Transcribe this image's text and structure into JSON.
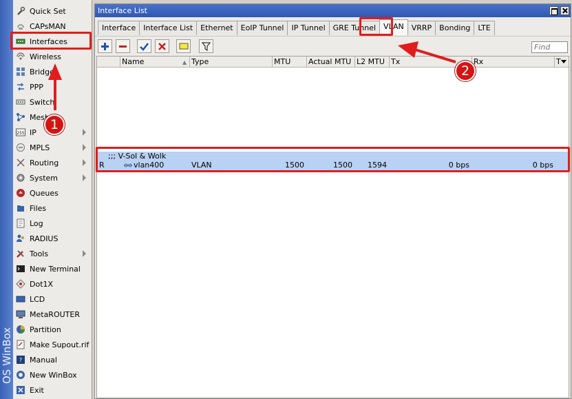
{
  "brand": {
    "text": "OS WinBox"
  },
  "sidebar": {
    "items": [
      {
        "label": "Quick Set",
        "icon": "wrench-icon",
        "submenu": false
      },
      {
        "label": "CAPsMAN",
        "icon": "capsman-icon",
        "submenu": false
      },
      {
        "label": "Interfaces",
        "icon": "interfaces-icon",
        "submenu": false
      },
      {
        "label": "Wireless",
        "icon": "wireless-icon",
        "submenu": false
      },
      {
        "label": "Bridge",
        "icon": "bridge-icon",
        "submenu": false
      },
      {
        "label": "PPP",
        "icon": "ppp-icon",
        "submenu": false
      },
      {
        "label": "Switch",
        "icon": "switch-icon",
        "submenu": false
      },
      {
        "label": "Mesh",
        "icon": "mesh-icon",
        "submenu": false
      },
      {
        "label": "IP",
        "icon": "ip-icon",
        "submenu": true
      },
      {
        "label": "MPLS",
        "icon": "mpls-icon",
        "submenu": true
      },
      {
        "label": "Routing",
        "icon": "routing-icon",
        "submenu": true
      },
      {
        "label": "System",
        "icon": "system-icon",
        "submenu": true
      },
      {
        "label": "Queues",
        "icon": "queues-icon",
        "submenu": false
      },
      {
        "label": "Files",
        "icon": "files-icon",
        "submenu": false
      },
      {
        "label": "Log",
        "icon": "log-icon",
        "submenu": false
      },
      {
        "label": "RADIUS",
        "icon": "radius-icon",
        "submenu": false
      },
      {
        "label": "Tools",
        "icon": "tools-icon",
        "submenu": true
      },
      {
        "label": "New Terminal",
        "icon": "terminal-icon",
        "submenu": false
      },
      {
        "label": "Dot1X",
        "icon": "dot1x-icon",
        "submenu": false
      },
      {
        "label": "LCD",
        "icon": "lcd-icon",
        "submenu": false
      },
      {
        "label": "MetaROUTER",
        "icon": "metarouter-icon",
        "submenu": false
      },
      {
        "label": "Partition",
        "icon": "partition-icon",
        "submenu": false
      },
      {
        "label": "Make Supout.rif",
        "icon": "supout-icon",
        "submenu": false
      },
      {
        "label": "Manual",
        "icon": "manual-icon",
        "submenu": false
      },
      {
        "label": "New WinBox",
        "icon": "winbox-icon",
        "submenu": false
      },
      {
        "label": "Exit",
        "icon": "exit-icon",
        "submenu": false
      }
    ]
  },
  "window": {
    "title": "Interface List",
    "tabs": [
      "Interface",
      "Interface List",
      "Ethernet",
      "EoIP Tunnel",
      "IP Tunnel",
      "GRE Tunnel",
      "VLAN",
      "VRRP",
      "Bonding",
      "LTE"
    ],
    "active_tab": "VLAN",
    "find_placeholder": "Find",
    "columns": [
      "Name",
      "Type",
      "MTU",
      "Actual MTU",
      "L2 MTU",
      "Tx",
      "Rx",
      "T"
    ],
    "comment": ";;; V-Sol & Wolk",
    "rows": [
      {
        "flag": "R",
        "name": "vlan400",
        "type": "VLAN",
        "mtu": "1500",
        "actual_mtu": "1500",
        "l2_mtu": "1594",
        "tx": "0 bps",
        "rx": "0 bps"
      }
    ]
  },
  "annotations": {
    "step1": "1",
    "step2": "2"
  },
  "colors": {
    "highlight": "#e21c1c",
    "title_bar": "#2e58b4",
    "selected_row": "#b9d1f2"
  }
}
